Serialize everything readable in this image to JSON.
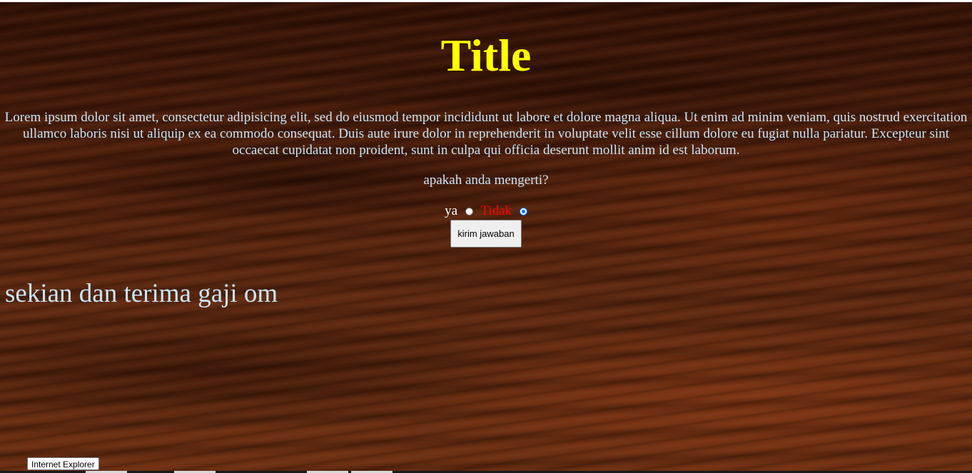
{
  "page": {
    "title": "Title",
    "paragraph": "Lorem ipsum dolor sit amet, consectetur adipisicing elit, sed do eiusmod tempor incididunt ut labore et dolore magna aliqua. Ut enim ad minim veniam, quis nostrud exercitation ullamco laboris nisi ut aliquip ex ea commodo consequat. Duis aute irure dolor in reprehenderit in voluptate velit esse cillum dolore eu fugiat nulla pariatur. Excepteur sint occaecat cupidatat non proident, sunt in culpa qui officia deserunt mollit anim id est laborum.",
    "question": "apakah anda mengerti?",
    "closing": "sekian dan terima gaji om"
  },
  "form": {
    "option_yes_label": "ya",
    "option_no_label": "Tidak",
    "selected": "Tidak",
    "submit_label": "kirim jawaban"
  },
  "tooltip": {
    "text": "Internet Explorer"
  },
  "colors": {
    "title": "#ffff00",
    "body_text": "#c9e6f5",
    "option_no": "#ff0000",
    "radio_selected": "#0075ff"
  }
}
